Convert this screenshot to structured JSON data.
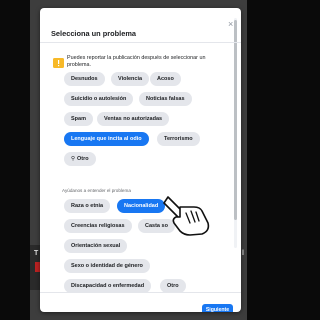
{
  "background": {
    "partial_left": "T",
    "partial_right": "l"
  },
  "dialog": {
    "title": "Selecciona un problema",
    "close_label": "×",
    "notice": "Puedes reportar la publicación después de seleccionar un problema.",
    "problems": [
      {
        "label": "Desnudos",
        "selected": false
      },
      {
        "label": "Violencia",
        "selected": false
      },
      {
        "label": "Acoso",
        "selected": false
      },
      {
        "label": "Suicidio o autolesión",
        "selected": false
      },
      {
        "label": "Noticias falsas",
        "selected": false
      },
      {
        "label": "Spam",
        "selected": false
      },
      {
        "label": "Ventas no autorizadas",
        "selected": false
      },
      {
        "label": "Lenguaje que incita al odio",
        "selected": true
      },
      {
        "label": "Terrorismo",
        "selected": false
      }
    ],
    "other_label": "Otro",
    "section_label": "Ayúdanos a entender el problema",
    "sub_problems": [
      {
        "label": "Raza o etnia",
        "selected": false
      },
      {
        "label": "Nacionalidad",
        "selected": true
      },
      {
        "label": "Creencias religiosas",
        "selected": false
      },
      {
        "label": "Casta so",
        "selected": false
      },
      {
        "label": "Orientación sexual",
        "selected": false
      },
      {
        "label": "Sexo o identidad de género",
        "selected": false
      },
      {
        "label": "Discapacidad o enfermedad",
        "selected": false
      },
      {
        "label": "Otro",
        "selected": false
      }
    ],
    "next_label": "Siguiente"
  },
  "colors": {
    "accent": "#1877f2",
    "chip_bg": "#e4e6eb",
    "warning": "#f7b928"
  },
  "icons": {
    "warning": "warning-icon",
    "search": "search-icon",
    "pointer": "hand-pointer-icon",
    "close": "close-icon"
  }
}
